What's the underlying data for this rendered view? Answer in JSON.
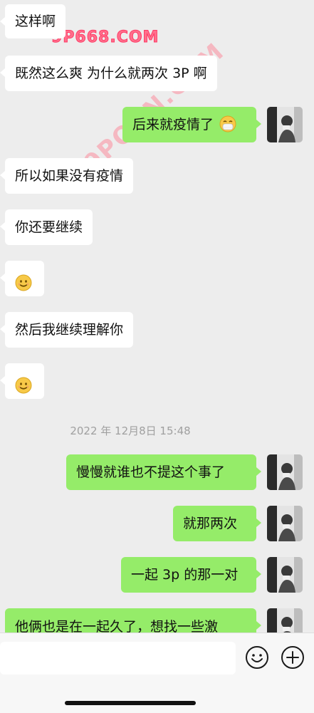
{
  "watermarks": {
    "top": "9P668.COM",
    "diagonal": "9PORN.COM"
  },
  "messages": [
    {
      "side": "left",
      "text": "这样啊"
    },
    {
      "side": "left",
      "text": "既然这么爽 为什么就两次 3P 啊"
    },
    {
      "side": "right",
      "text": "后来就疫情了",
      "emoji": "mask-face"
    },
    {
      "side": "left",
      "text": "所以如果没有疫情"
    },
    {
      "side": "left",
      "text": "你还要继续"
    },
    {
      "side": "left",
      "text": "",
      "emoji": "smile"
    },
    {
      "side": "left",
      "text": "然后我继续理解你"
    },
    {
      "side": "left",
      "text": "",
      "emoji": "smile"
    },
    {
      "side": "right",
      "text": "慢慢就谁也不提这个事了"
    },
    {
      "side": "right",
      "text": "就那两次"
    },
    {
      "side": "right",
      "text": "一起 3p 的那一对"
    },
    {
      "side": "right",
      "text": "他俩也是在一起久了，想找一些激"
    }
  ],
  "timestamp": "2022 年 12月8日 15:48",
  "input_bar": {
    "placeholder": "",
    "emoji_icon": "emoji-icon",
    "plus_icon": "plus-icon"
  },
  "colors": {
    "background": "#ededed",
    "incoming_bubble": "#ffffff",
    "outgoing_bubble": "#95ec69",
    "timestamp_text": "#a0a0a0"
  }
}
